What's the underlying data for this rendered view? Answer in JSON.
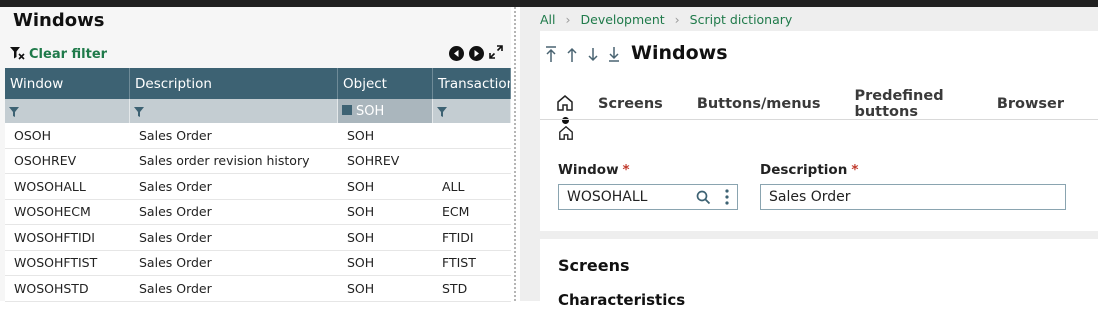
{
  "left": {
    "title": "Windows",
    "clear_filter": "Clear filter",
    "columns": [
      "Window",
      "Description",
      "Object",
      "Transaction"
    ],
    "filter_object_value": "SOH",
    "rows": [
      [
        "OSOH",
        "Sales Order",
        "SOH",
        ""
      ],
      [
        "OSOHREV",
        "Sales order revision history",
        "SOHREV",
        ""
      ],
      [
        "WOSOHALL",
        "Sales Order",
        "SOH",
        "ALL"
      ],
      [
        "WOSOHECM",
        "Sales Order",
        "SOH",
        "ECM"
      ],
      [
        "WOSOHFTIDI",
        "Sales Order",
        "SOH",
        "FTIDI"
      ],
      [
        "WOSOHFTIST",
        "Sales Order",
        "SOH",
        "FTIST"
      ],
      [
        "WOSOHSTD",
        "Sales Order",
        "SOH",
        "STD"
      ]
    ]
  },
  "right": {
    "breadcrumb": [
      "All",
      "Development",
      "Script dictionary"
    ],
    "title": "Windows",
    "tabs": [
      "Screens",
      "Buttons/menus",
      "Predefined buttons",
      "Browser"
    ],
    "window_label": "Window",
    "window_value": "WOSOHALL",
    "description_label": "Description",
    "description_value": "Sales Order",
    "section_title": "Screens",
    "section_sub": "Characteristics"
  },
  "colors": {
    "accent_green": "#1f7a4a",
    "grid_header": "#3d6273",
    "required": "#c0392b"
  }
}
